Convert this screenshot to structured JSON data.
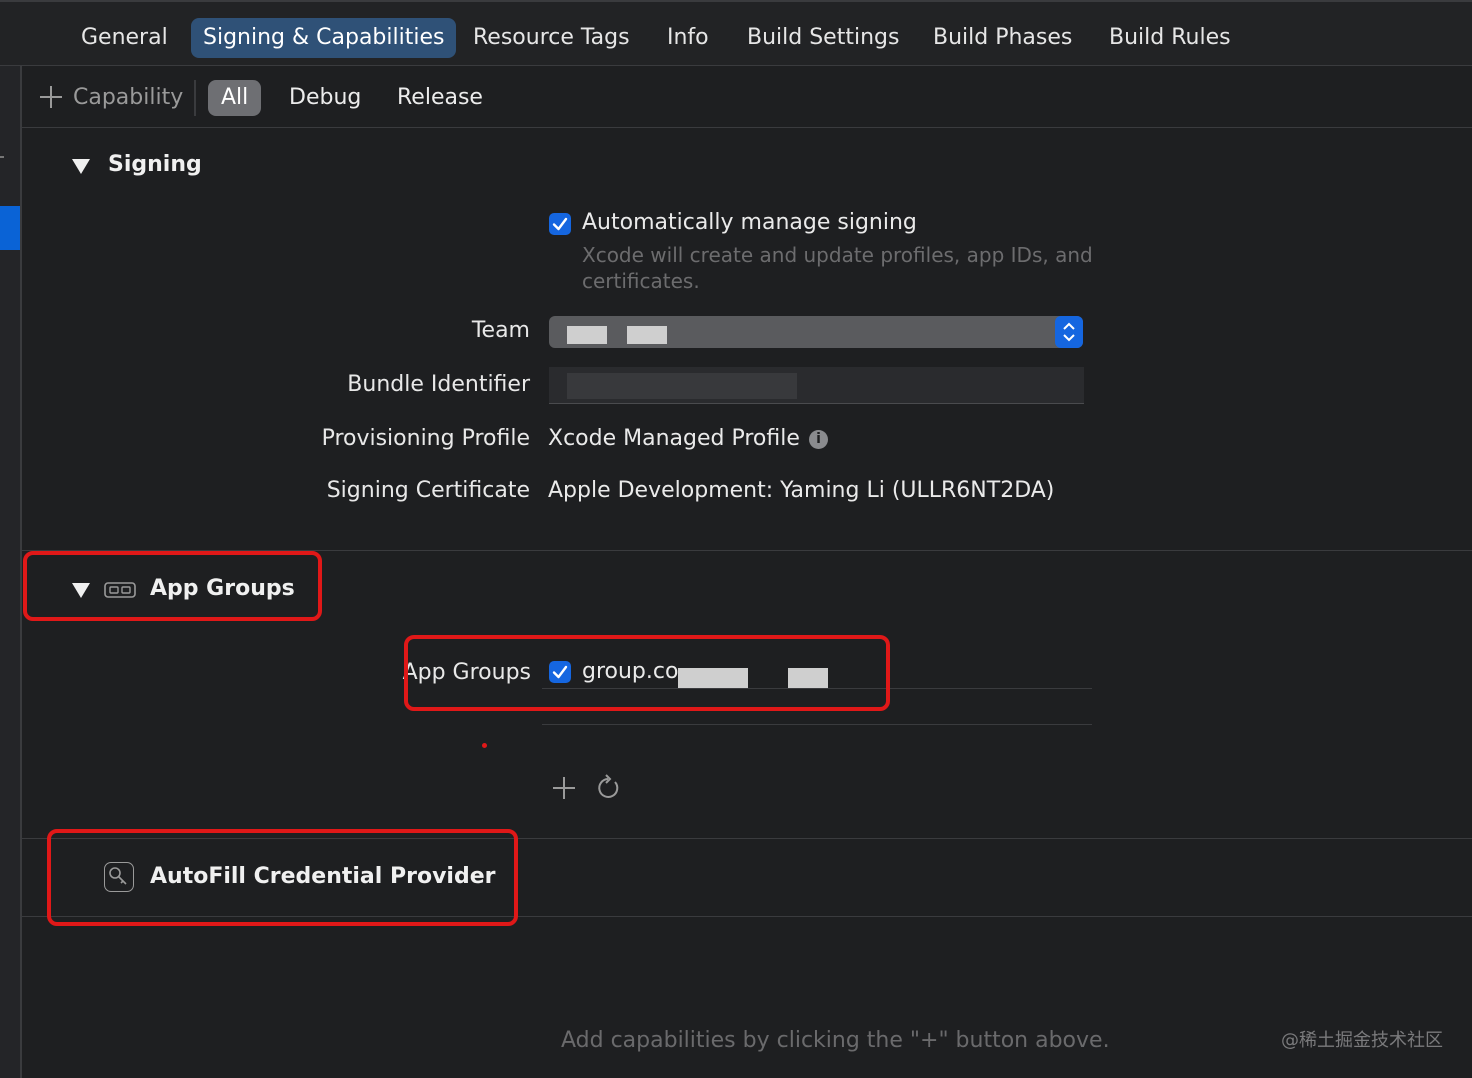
{
  "tabs": [
    "General",
    "Signing & Capabilities",
    "Resource Tags",
    "Info",
    "Build Settings",
    "Build Phases",
    "Build Rules"
  ],
  "subbar": {
    "capability_label": "Capability",
    "filters": [
      "All",
      "Debug",
      "Release"
    ],
    "active_filter": "All"
  },
  "signing": {
    "title": "Signing",
    "auto_manage_label": "Automatically manage signing",
    "auto_manage_checked": true,
    "auto_manage_note_line1": "Xcode will create and update profiles, app IDs, and",
    "auto_manage_note_line2": "certificates.",
    "team_label": "Team",
    "bundle_id_label": "Bundle Identifier",
    "provisioning_label": "Provisioning Profile",
    "provisioning_value": "Xcode Managed Profile",
    "certificate_label": "Signing Certificate",
    "certificate_value": "Apple Development: Yaming Li (ULLR6NT2DA)"
  },
  "app_groups": {
    "title": "App Groups",
    "field_label": "App Groups",
    "group_checked": true,
    "group_value": "group.co"
  },
  "autofill": {
    "title": "AutoFill Credential Provider"
  },
  "footer": {
    "hint": "Add capabilities by clicking the \"+\" button above.",
    "watermark": "@稀土掘金技术社区"
  },
  "colors": {
    "accent": "#1566e0",
    "annotation_red": "#e01818",
    "active_tab": "#2f5177"
  },
  "icons": [
    "plus-icon",
    "disclosure-triangle-icon",
    "checkbox-icon",
    "info-icon",
    "app-groups-icon",
    "refresh-icon",
    "autofill-key-icon",
    "popup-stepper-icon"
  ]
}
